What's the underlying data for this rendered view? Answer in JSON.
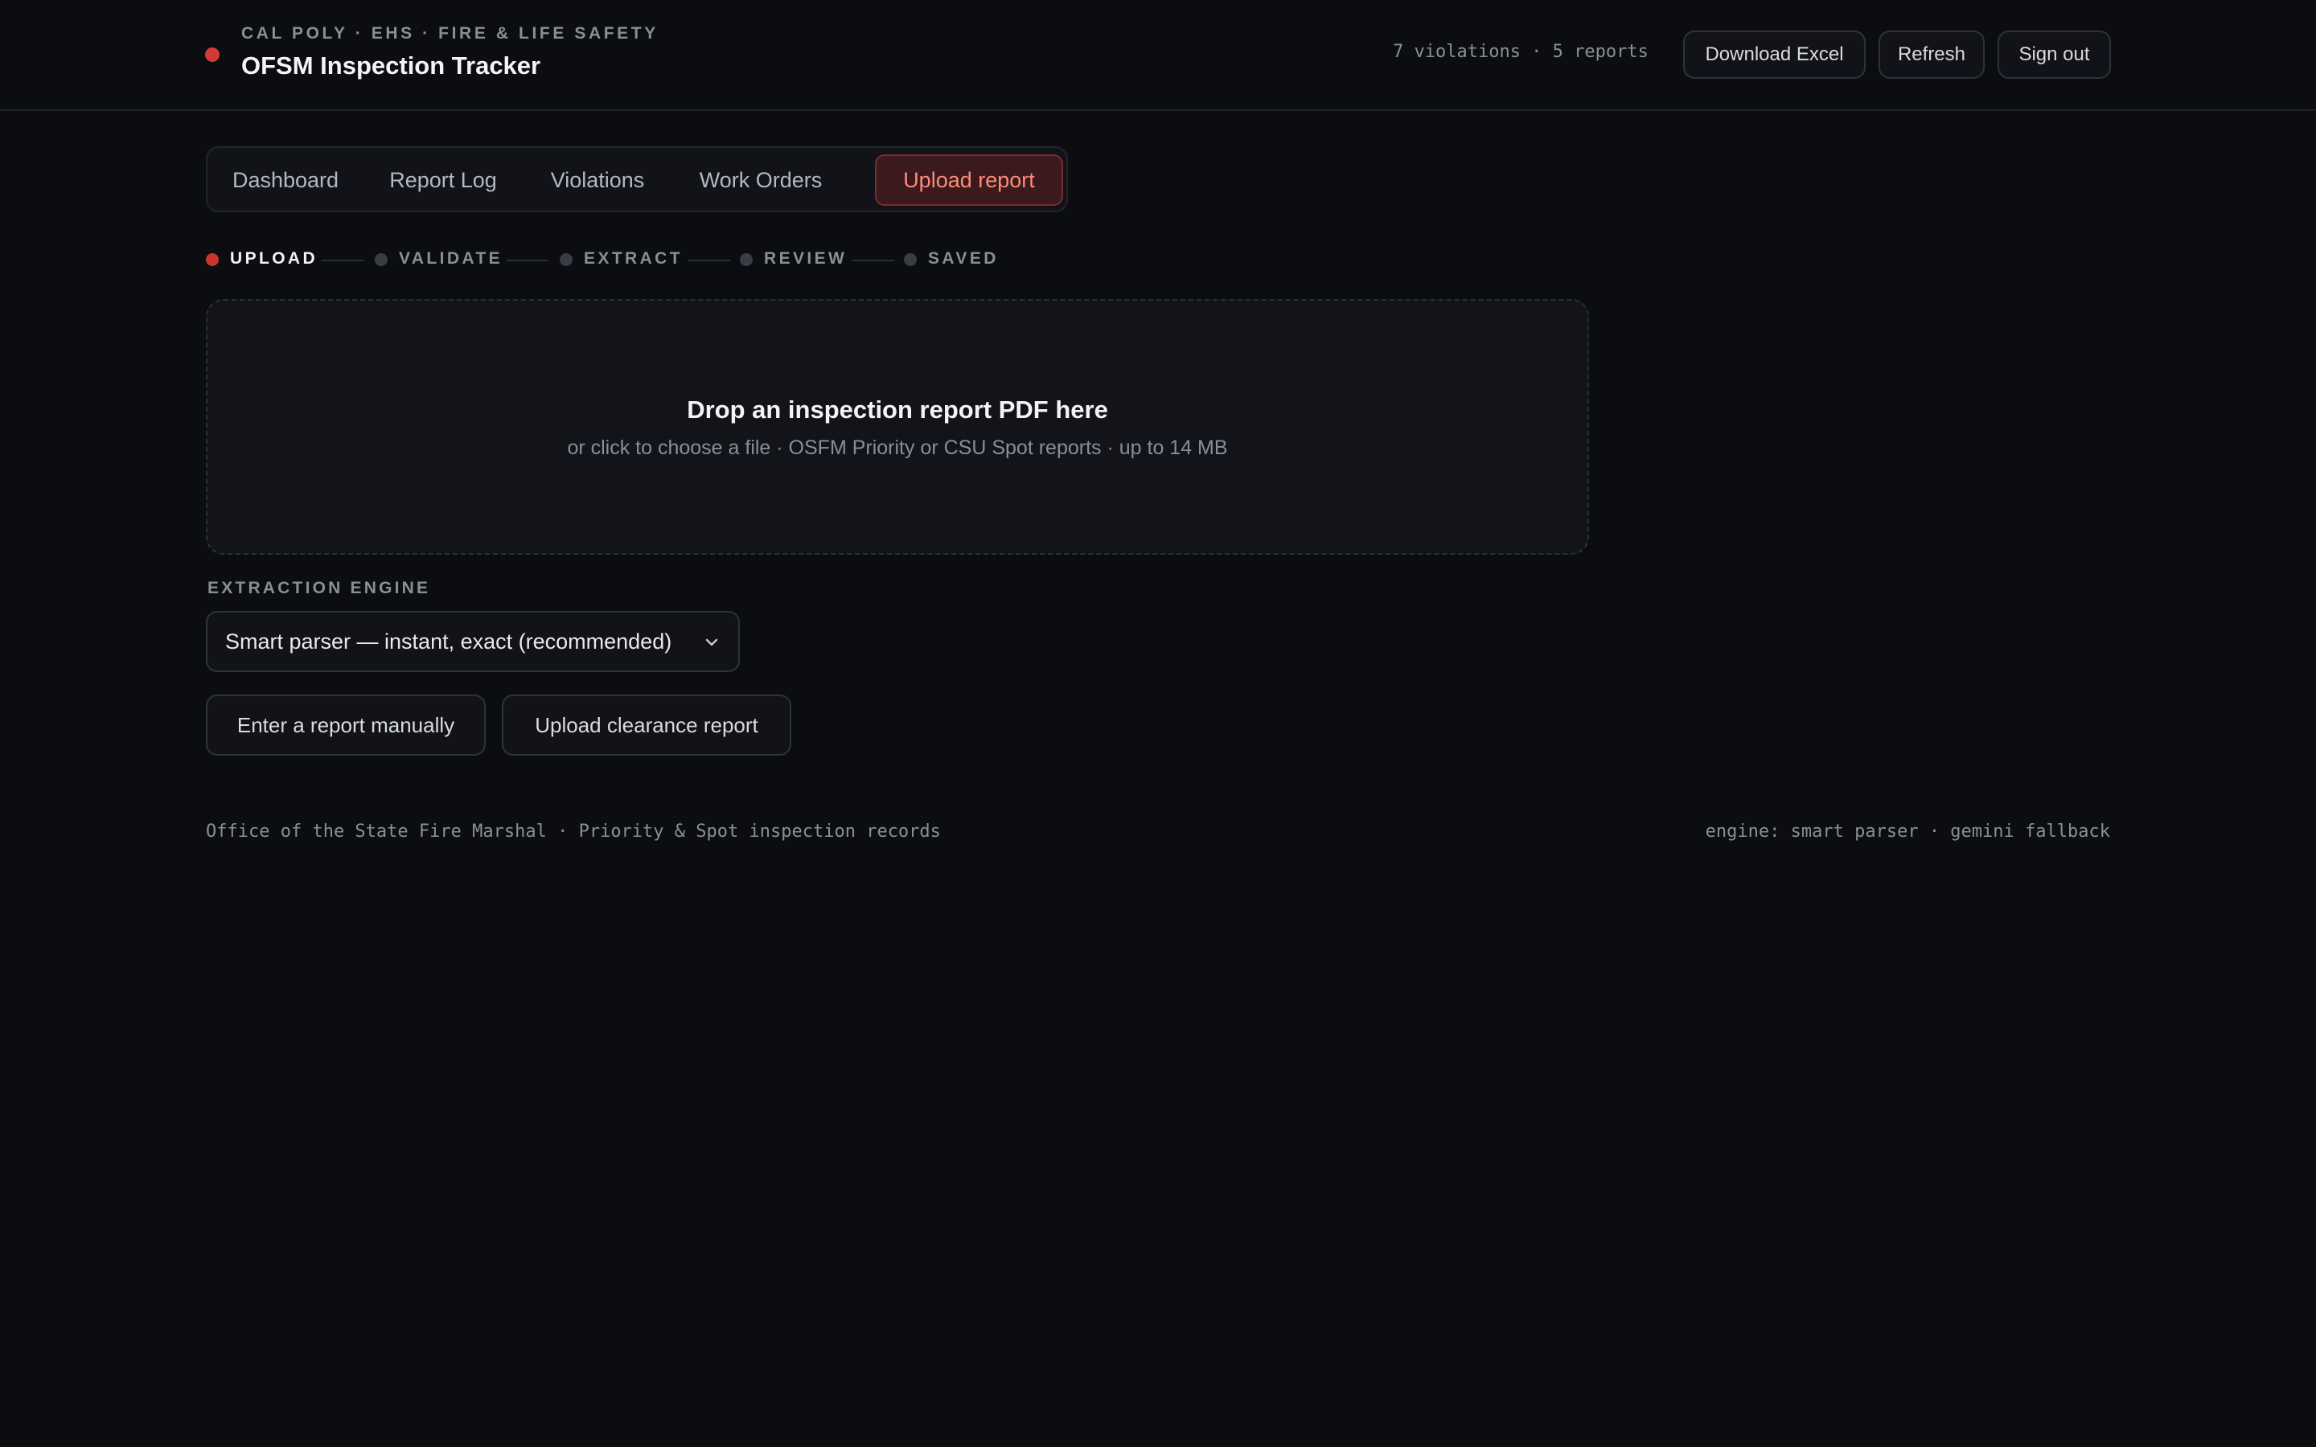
{
  "header": {
    "org_line": "CAL POLY · EHS · FIRE & LIFE SAFETY",
    "title": "OFSM Inspection Tracker",
    "stats": "7 violations · 5 reports",
    "download_label": "Download Excel",
    "refresh_label": "Refresh",
    "signout_label": "Sign out",
    "status_color": "#d23a33"
  },
  "tabs": [
    {
      "label": "Dashboard",
      "active": false
    },
    {
      "label": "Report Log",
      "active": false
    },
    {
      "label": "Violations",
      "active": false
    },
    {
      "label": "Work Orders",
      "active": false
    },
    {
      "label": "Upload report",
      "active": true
    }
  ],
  "stepper": [
    {
      "label": "UPLOAD",
      "active": true
    },
    {
      "label": "VALIDATE",
      "active": false
    },
    {
      "label": "EXTRACT",
      "active": false
    },
    {
      "label": "REVIEW",
      "active": false
    },
    {
      "label": "SAVED",
      "active": false
    }
  ],
  "dropzone": {
    "title": "Drop an inspection report PDF here",
    "subtitle": "or click to choose a file · OSFM Priority or CSU Spot reports · up to 14 MB"
  },
  "engine": {
    "label": "EXTRACTION ENGINE",
    "selected": "Smart parser — instant, exact (recommended)",
    "icon": "chevron-down-icon"
  },
  "actions": {
    "manual_label": "Enter a report manually",
    "clearance_label": "Upload clearance report"
  },
  "footer": {
    "left": "Office of the State Fire Marshal · Priority & Spot inspection records",
    "right": "engine: smart parser · gemini fallback"
  },
  "colors": {
    "accent": "#c93631",
    "accent_text": "#ff8a7a",
    "background": "#0c0d10"
  }
}
